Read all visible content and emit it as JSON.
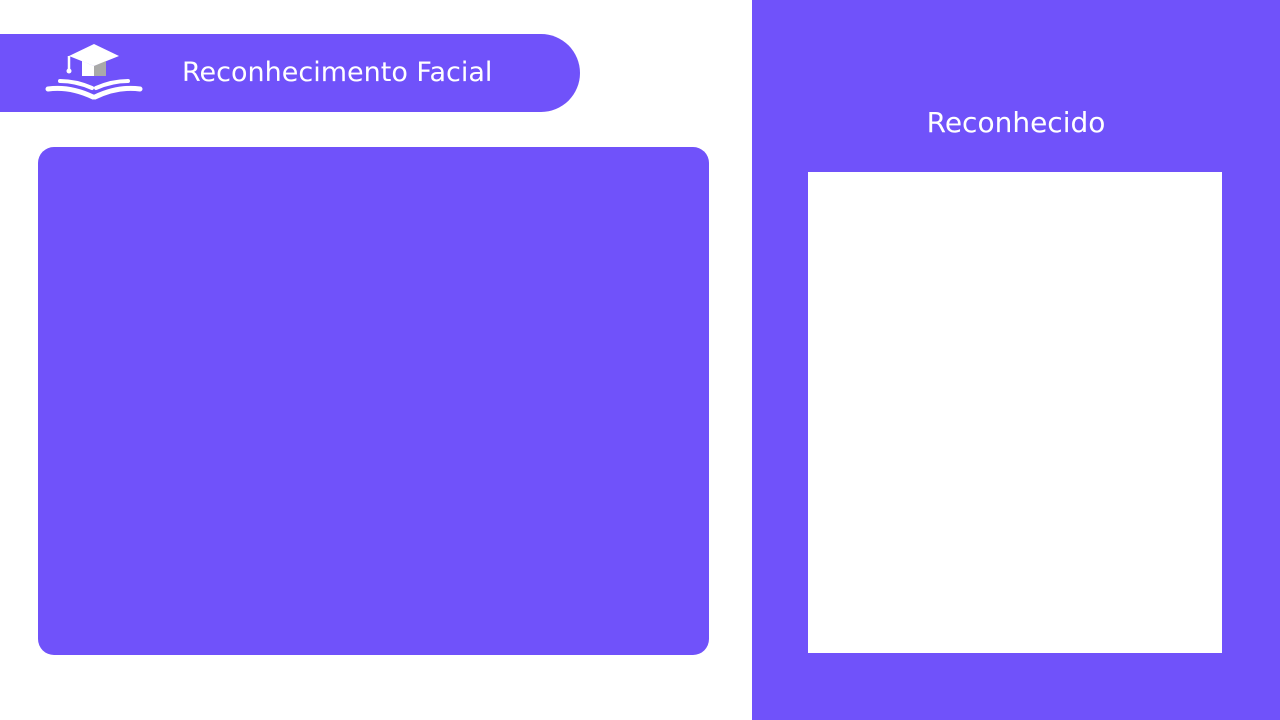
{
  "header": {
    "title": "Reconhecimento Facial",
    "logo_icon": "graduation-cap-book-icon"
  },
  "camera": {
    "state": "empty"
  },
  "result_panel": {
    "title": "Reconhecido"
  },
  "colors": {
    "accent": "#7052fa",
    "background": "#ffffff",
    "text_on_accent": "#ffffff",
    "logo_cap_side": "#a9a9a9"
  }
}
